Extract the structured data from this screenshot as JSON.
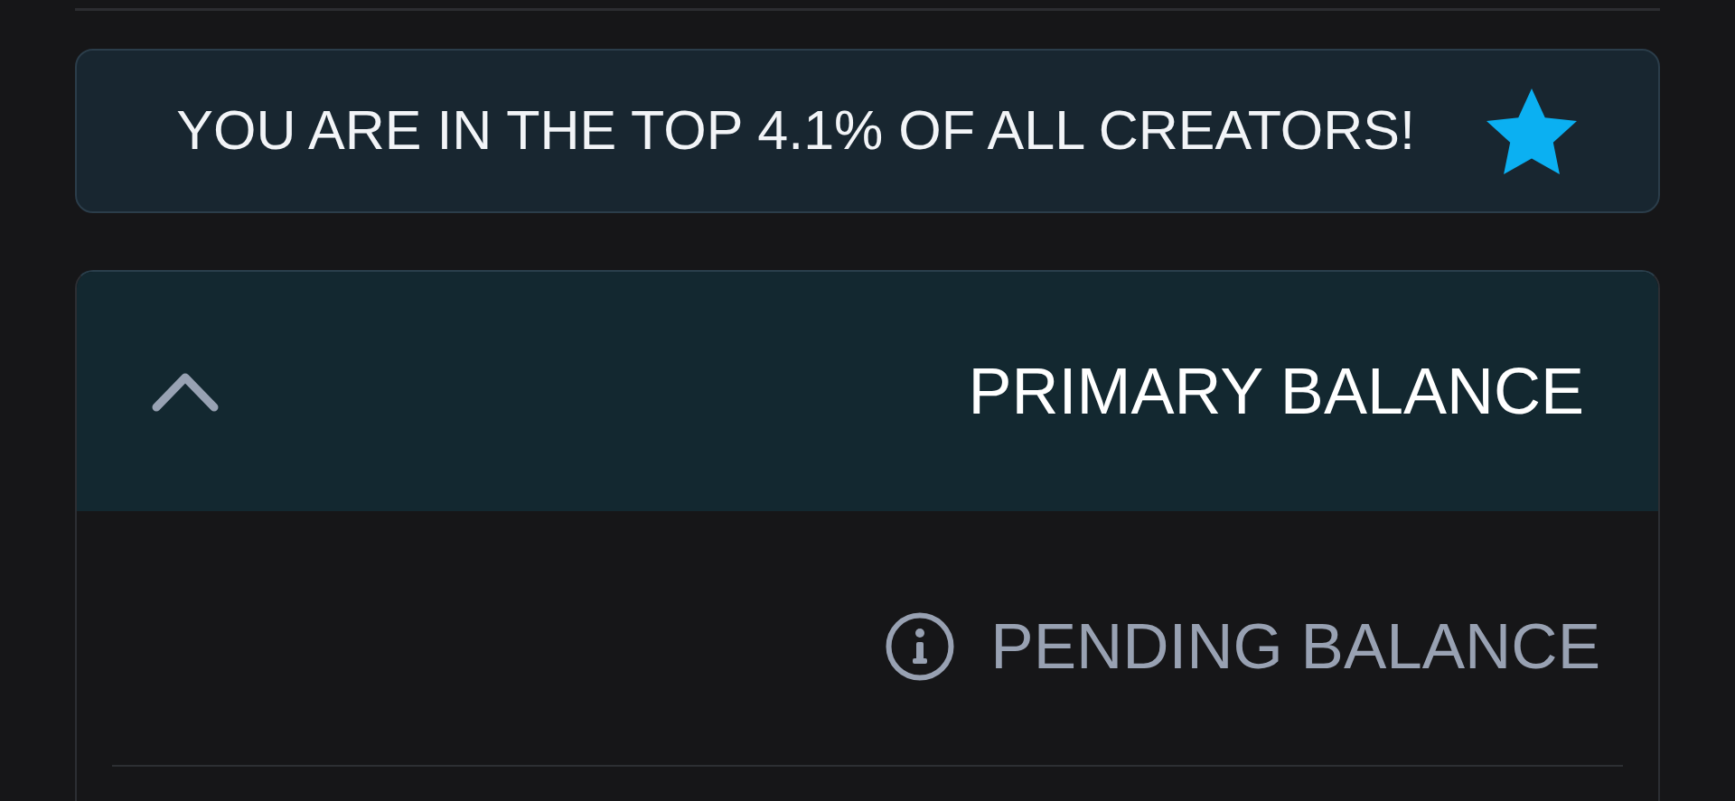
{
  "banner": {
    "text": "YOU ARE IN THE TOP 4.1% OF ALL CREATORS!"
  },
  "balance_card": {
    "title": "PRIMARY BALANCE",
    "expanded": true,
    "rows": [
      {
        "label": "PENDING BALANCE"
      }
    ]
  }
}
